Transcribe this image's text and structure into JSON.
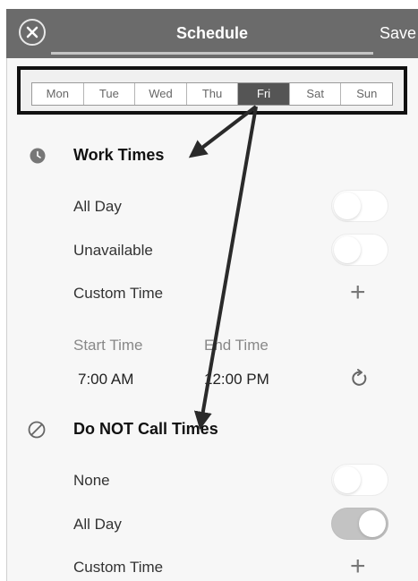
{
  "header": {
    "title": "Schedule",
    "save_label": "Save",
    "close_icon": "close-circle-icon"
  },
  "days": {
    "items": [
      "Mon",
      "Tue",
      "Wed",
      "Thu",
      "Fri",
      "Sat",
      "Sun"
    ],
    "selected": "Fri"
  },
  "work_times": {
    "icon": "clock-icon",
    "title": "Work Times",
    "rows": [
      {
        "label": "All Day",
        "toggle_on": false
      },
      {
        "label": "Unavailable",
        "toggle_on": false
      }
    ],
    "custom_time_label": "Custom Time",
    "start_time_label": "Start Time",
    "end_time_label": "End Time",
    "start_time_value": "7:00 AM",
    "end_time_value": "12:00 PM",
    "refresh_icon": "refresh-icon"
  },
  "do_not_call": {
    "icon": "no-entry-icon",
    "title": "Do NOT Call Times",
    "rows": [
      {
        "label": "None",
        "toggle_on": false
      },
      {
        "label": "All Day",
        "toggle_on": true
      }
    ],
    "custom_time_label": "Custom Time"
  },
  "colors": {
    "header_bg": "#6b6b6b",
    "selected_day_bg": "#555555",
    "annotation": "#2a2a2a"
  }
}
